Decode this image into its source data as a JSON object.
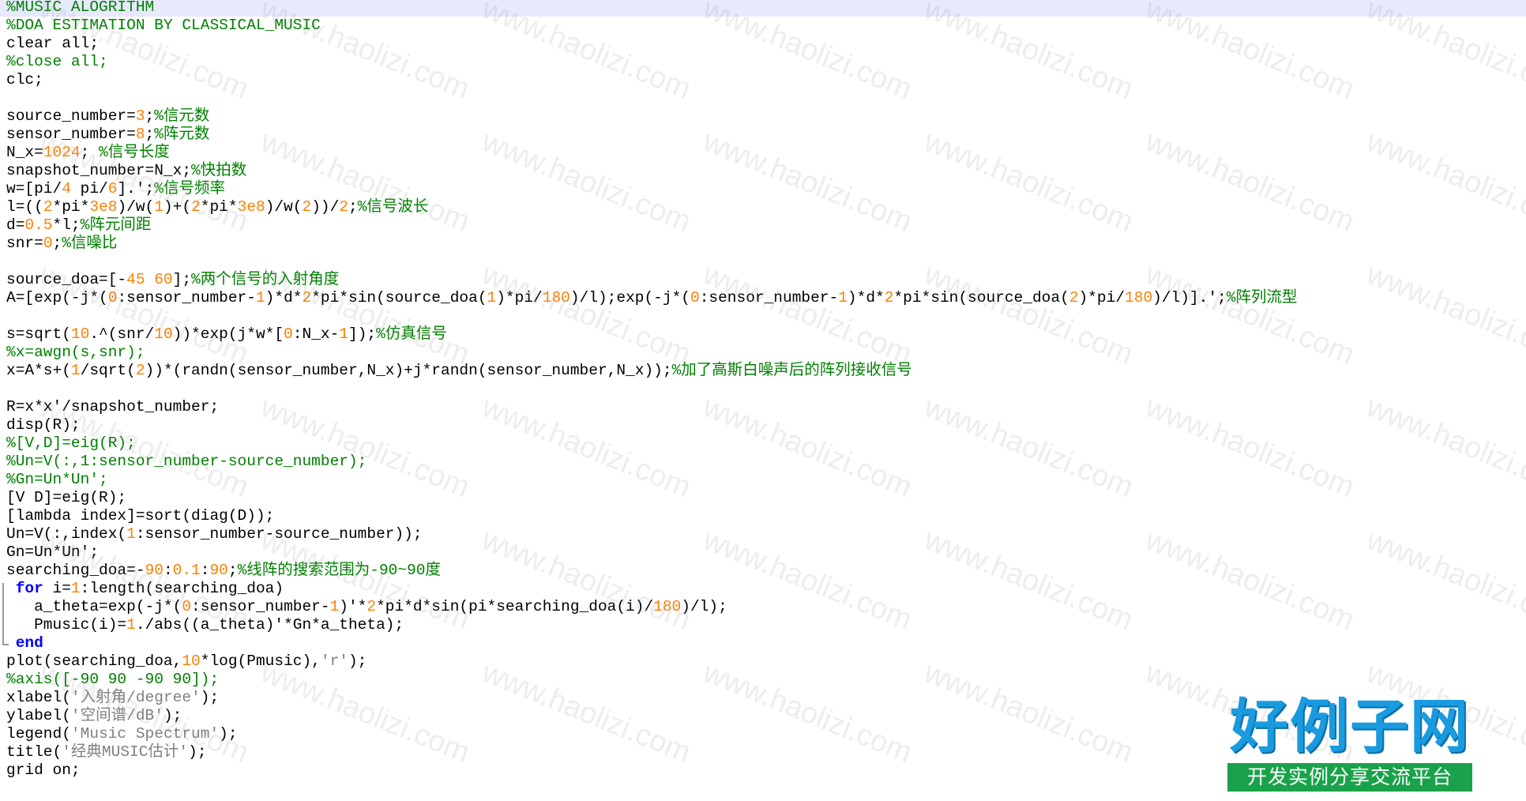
{
  "editor": {
    "lines": [
      [
        {
          "t": "%MUSIC ALOGRITHM",
          "c": "c"
        }
      ],
      [
        {
          "t": "%DOA ESTIMATION BY CLASSICAL_MUSIC",
          "c": "c"
        }
      ],
      [
        {
          "t": "clear all;"
        }
      ],
      [
        {
          "t": "%close all;",
          "c": "c"
        }
      ],
      [
        {
          "t": "clc;"
        }
      ],
      [],
      [
        {
          "t": "source_number="
        },
        {
          "t": "3",
          "c": "n"
        },
        {
          "t": ";"
        },
        {
          "t": "%信元数",
          "c": "c"
        }
      ],
      [
        {
          "t": "sensor_number="
        },
        {
          "t": "8",
          "c": "n"
        },
        {
          "t": ";"
        },
        {
          "t": "%阵元数",
          "c": "c"
        }
      ],
      [
        {
          "t": "N_x="
        },
        {
          "t": "1024",
          "c": "n"
        },
        {
          "t": "; "
        },
        {
          "t": "%信号长度",
          "c": "c"
        }
      ],
      [
        {
          "t": "snapshot_number=N_x;"
        },
        {
          "t": "%快拍数",
          "c": "c"
        }
      ],
      [
        {
          "t": "w=[pi/"
        },
        {
          "t": "4",
          "c": "n"
        },
        {
          "t": " pi/"
        },
        {
          "t": "6",
          "c": "n"
        },
        {
          "t": "].';"
        },
        {
          "t": "%信号频率",
          "c": "c"
        }
      ],
      [
        {
          "t": "l=(("
        },
        {
          "t": "2",
          "c": "n"
        },
        {
          "t": "*pi*"
        },
        {
          "t": "3e8",
          "c": "n"
        },
        {
          "t": ")/w("
        },
        {
          "t": "1",
          "c": "n"
        },
        {
          "t": ")+("
        },
        {
          "t": "2",
          "c": "n"
        },
        {
          "t": "*pi*"
        },
        {
          "t": "3e8",
          "c": "n"
        },
        {
          "t": ")/w("
        },
        {
          "t": "2",
          "c": "n"
        },
        {
          "t": "))/"
        },
        {
          "t": "2",
          "c": "n"
        },
        {
          "t": ";"
        },
        {
          "t": "%信号波长",
          "c": "c"
        }
      ],
      [
        {
          "t": "d="
        },
        {
          "t": "0.5",
          "c": "n"
        },
        {
          "t": "*l;"
        },
        {
          "t": "%阵元间距",
          "c": "c"
        }
      ],
      [
        {
          "t": "snr="
        },
        {
          "t": "0",
          "c": "n"
        },
        {
          "t": ";"
        },
        {
          "t": "%信噪比",
          "c": "c"
        }
      ],
      [],
      [
        {
          "t": "source_doa=[-"
        },
        {
          "t": "45",
          "c": "n"
        },
        {
          "t": " "
        },
        {
          "t": "60",
          "c": "n"
        },
        {
          "t": "];"
        },
        {
          "t": "%两个信号的入射角度",
          "c": "c"
        }
      ],
      [
        {
          "t": "A=[exp(-j*("
        },
        {
          "t": "0",
          "c": "n"
        },
        {
          "t": ":sensor_number-"
        },
        {
          "t": "1",
          "c": "n"
        },
        {
          "t": ")*d*"
        },
        {
          "t": "2",
          "c": "n"
        },
        {
          "t": "*pi*sin(source_doa("
        },
        {
          "t": "1",
          "c": "n"
        },
        {
          "t": ")*pi/"
        },
        {
          "t": "180",
          "c": "n"
        },
        {
          "t": ")/l);exp(-j*("
        },
        {
          "t": "0",
          "c": "n"
        },
        {
          "t": ":sensor_number-"
        },
        {
          "t": "1",
          "c": "n"
        },
        {
          "t": ")*d*"
        },
        {
          "t": "2",
          "c": "n"
        },
        {
          "t": "*pi*sin(source_doa("
        },
        {
          "t": "2",
          "c": "n"
        },
        {
          "t": ")*pi/"
        },
        {
          "t": "180",
          "c": "n"
        },
        {
          "t": ")/l)].';"
        },
        {
          "t": "%阵列流型",
          "c": "c"
        }
      ],
      [],
      [
        {
          "t": "s=sqrt("
        },
        {
          "t": "10",
          "c": "n"
        },
        {
          "t": ".^(snr/"
        },
        {
          "t": "10",
          "c": "n"
        },
        {
          "t": "))*exp(j*w*["
        },
        {
          "t": "0",
          "c": "n"
        },
        {
          "t": ":N_x-"
        },
        {
          "t": "1",
          "c": "n"
        },
        {
          "t": "]);"
        },
        {
          "t": "%仿真信号",
          "c": "c"
        }
      ],
      [
        {
          "t": "%x=awgn(s,snr);",
          "c": "c"
        }
      ],
      [
        {
          "t": "x=A*s+("
        },
        {
          "t": "1",
          "c": "n"
        },
        {
          "t": "/sqrt("
        },
        {
          "t": "2",
          "c": "n"
        },
        {
          "t": "))*(randn(sensor_number,N_x)+j*randn(sensor_number,N_x));"
        },
        {
          "t": "%加了高斯白噪声后的阵列接收信号",
          "c": "c"
        }
      ],
      [],
      [
        {
          "t": "R=x*x'/snapshot_number;"
        }
      ],
      [
        {
          "t": "disp(R);"
        }
      ],
      [
        {
          "t": "%[V,D]=eig(R);",
          "c": "c"
        }
      ],
      [
        {
          "t": "%Un=V(:,1:sensor_number-source_number);",
          "c": "c"
        }
      ],
      [
        {
          "t": "%Gn=Un*Un';",
          "c": "c"
        }
      ],
      [
        {
          "t": "[V D]=eig(R);"
        }
      ],
      [
        {
          "t": "[lambda index]=sort(diag(D));"
        }
      ],
      [
        {
          "t": "Un=V(:,index("
        },
        {
          "t": "1",
          "c": "n"
        },
        {
          "t": ":sensor_number-source_number));"
        }
      ],
      [
        {
          "t": "Gn=Un*Un';"
        }
      ],
      [
        {
          "t": "searching_doa=-"
        },
        {
          "t": "90",
          "c": "n"
        },
        {
          "t": ":"
        },
        {
          "t": "0.1",
          "c": "n"
        },
        {
          "t": ":"
        },
        {
          "t": "90",
          "c": "n"
        },
        {
          "t": ";"
        },
        {
          "t": "%线阵的搜索范围为-90~90度",
          "c": "c"
        }
      ],
      [
        {
          "t": " "
        },
        {
          "t": "for",
          "c": "k"
        },
        {
          "t": " i="
        },
        {
          "t": "1",
          "c": "n"
        },
        {
          "t": ":length(searching_doa)"
        }
      ],
      [
        {
          "t": "   a_theta=exp(-j*("
        },
        {
          "t": "0",
          "c": "n"
        },
        {
          "t": ":sensor_number-"
        },
        {
          "t": "1",
          "c": "n"
        },
        {
          "t": ")'*"
        },
        {
          "t": "2",
          "c": "n"
        },
        {
          "t": "*pi*d*sin(pi*searching_doa(i)/"
        },
        {
          "t": "180",
          "c": "n"
        },
        {
          "t": ")/l);"
        }
      ],
      [
        {
          "t": "   Pmusic(i)="
        },
        {
          "t": "1",
          "c": "n"
        },
        {
          "t": "./abs((a_theta)'*Gn*a_theta);"
        }
      ],
      [
        {
          "t": " "
        },
        {
          "t": "end",
          "c": "k"
        }
      ],
      [
        {
          "t": "plot(searching_doa,"
        },
        {
          "t": "10",
          "c": "n"
        },
        {
          "t": "*log(Pmusic),"
        },
        {
          "t": "'r'",
          "c": "s"
        },
        {
          "t": ");"
        }
      ],
      [
        {
          "t": "%axis([-90 90 -90 90]);",
          "c": "c"
        }
      ],
      [
        {
          "t": "xlabel("
        },
        {
          "t": "'入射角/degree'",
          "c": "s"
        },
        {
          "t": ");"
        }
      ],
      [
        {
          "t": "ylabel("
        },
        {
          "t": "'空间谱/dB'",
          "c": "s"
        },
        {
          "t": ");"
        }
      ],
      [
        {
          "t": "legend("
        },
        {
          "t": "'Music Spectrum'",
          "c": "s"
        },
        {
          "t": ");"
        }
      ],
      [
        {
          "t": "title("
        },
        {
          "t": "'经典MUSIC估计'",
          "c": "s"
        },
        {
          "t": ");"
        }
      ],
      [
        {
          "t": "grid on;"
        }
      ]
    ]
  },
  "watermark": {
    "text": "www.haolizi.com"
  },
  "logo": {
    "main": "好例子网",
    "sub": "开发实例分享交流平台"
  },
  "colors": {
    "comment": "#008000",
    "number": "#ff8000",
    "string": "#808080",
    "keyword": "#0000ff",
    "current_line": "#e8e8ff"
  }
}
